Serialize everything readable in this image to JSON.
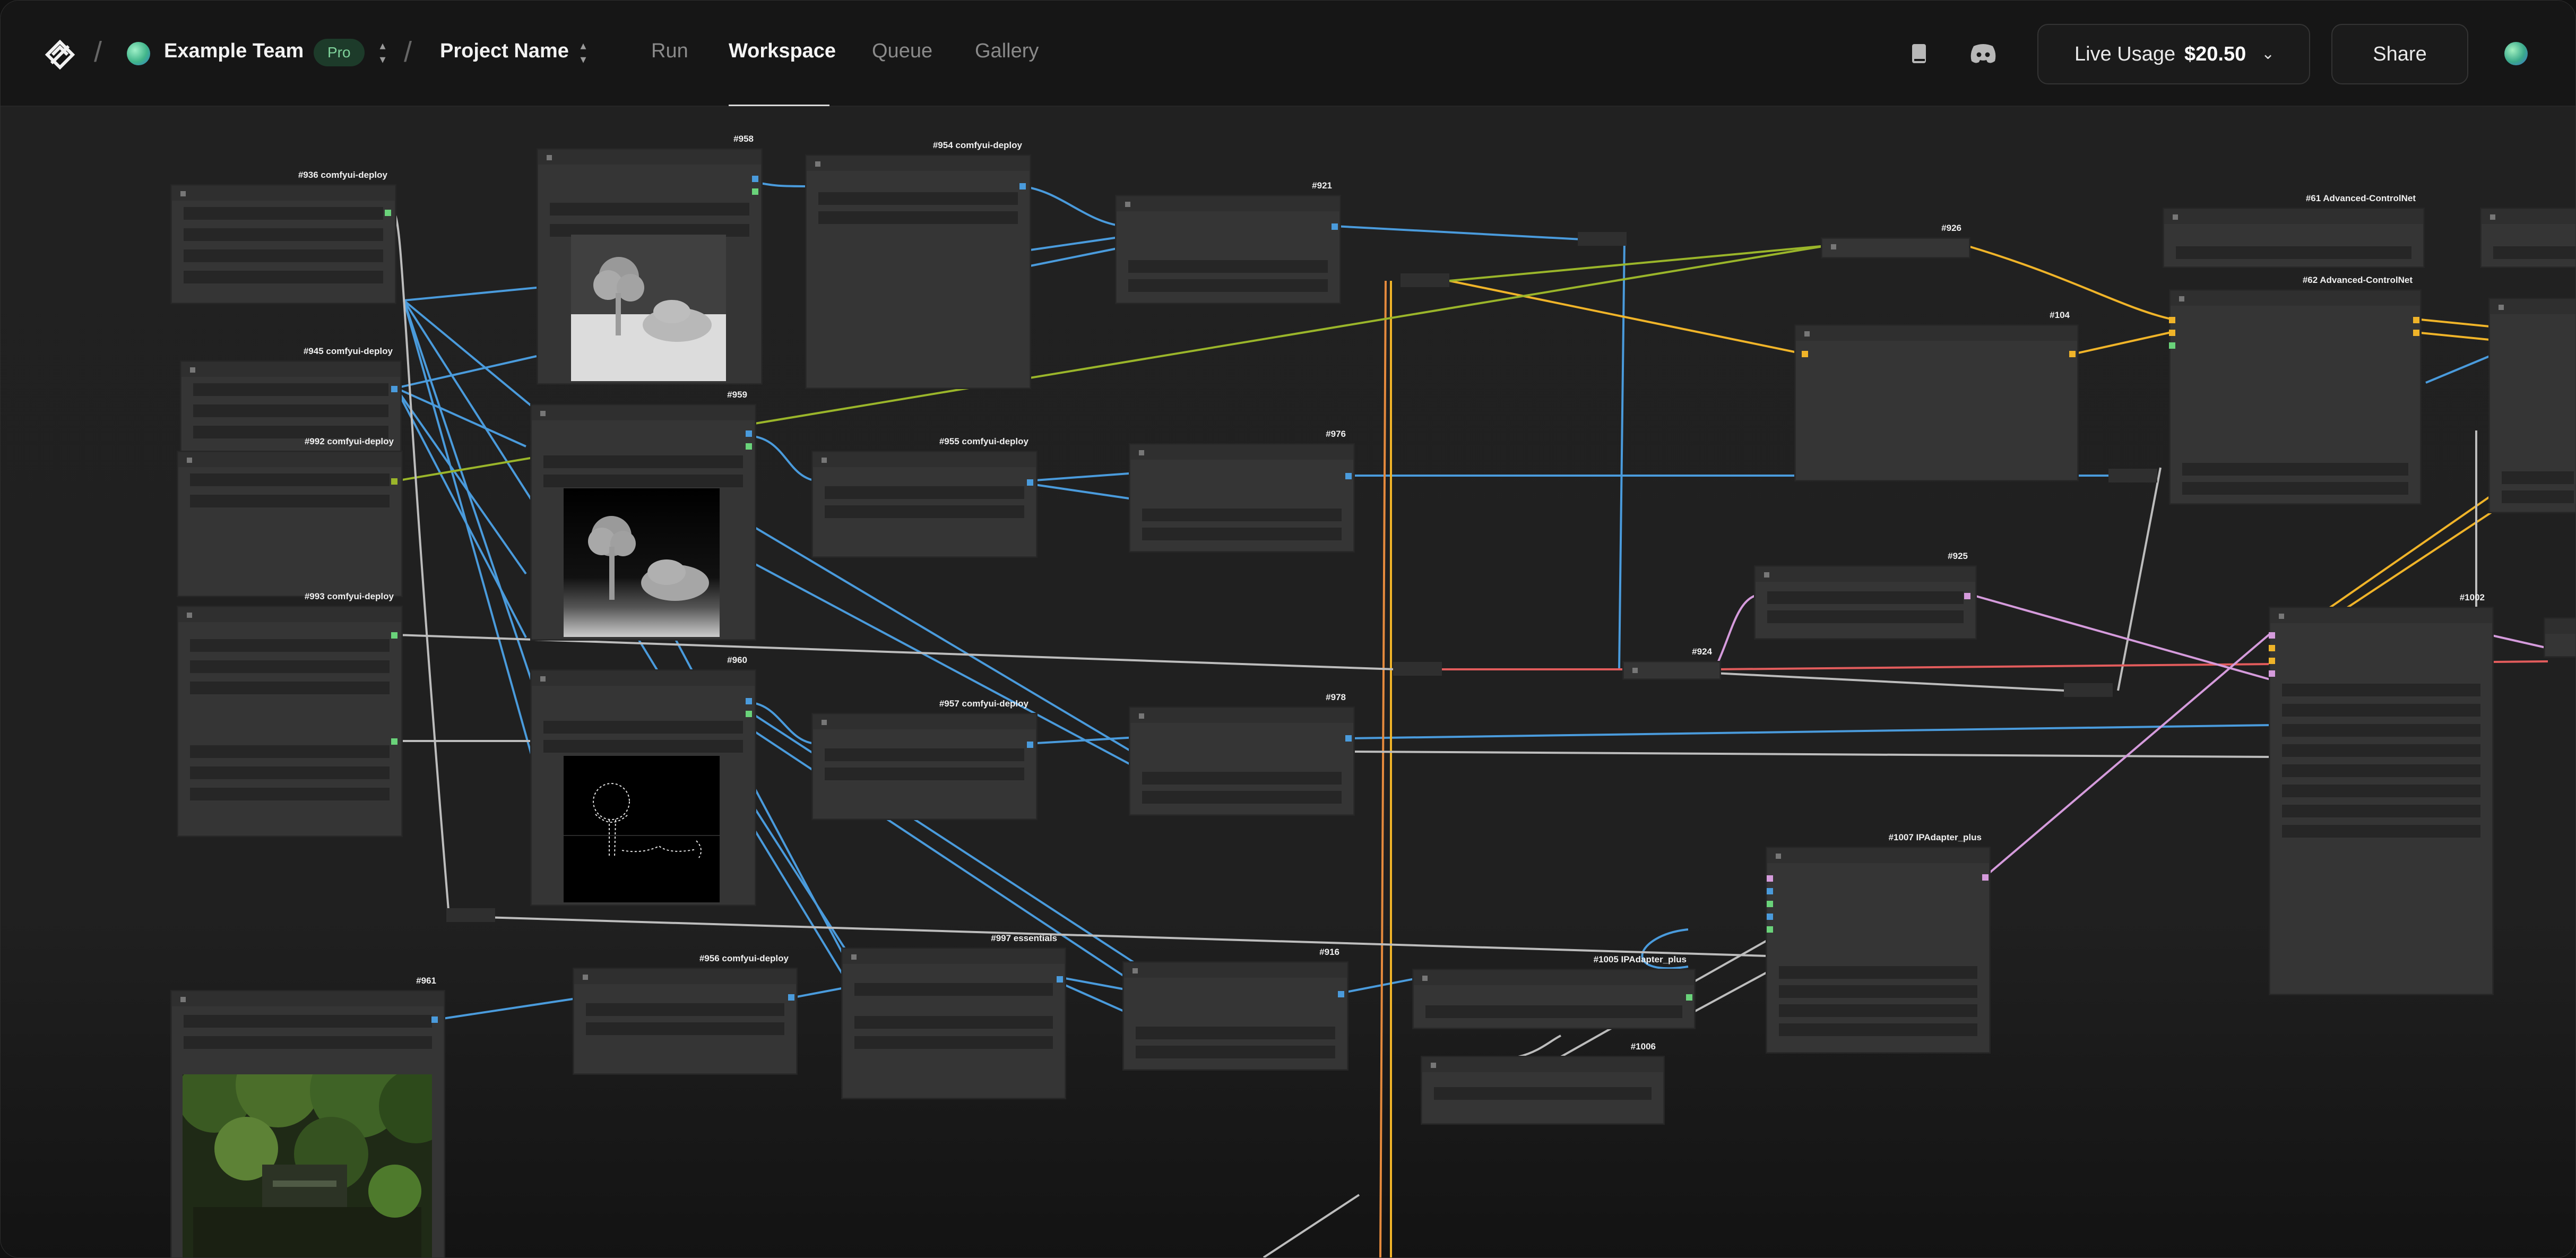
{
  "topbar": {
    "team_name": "Example Team",
    "plan_badge": "Pro",
    "project_name": "Project Name",
    "tabs": [
      {
        "label": "Run",
        "active": false
      },
      {
        "label": "Workspace",
        "active": true
      },
      {
        "label": "Queue",
        "active": false
      },
      {
        "label": "Gallery",
        "active": false
      }
    ],
    "live_usage_label": "Live Usage",
    "live_usage_amount": "$20.50",
    "share_label": "Share",
    "icons": [
      "logo-icon",
      "book-icon",
      "discord-icon",
      "chevron-down-icon"
    ]
  },
  "nodes": {
    "n936": "#936 comfyui-deploy",
    "n958": "#958",
    "n954": "#954 comfyui-deploy",
    "n921": "#921",
    "n926": "#926",
    "n61": "#61 Advanced-ControlNet",
    "n945": "#945 comfyui-deploy",
    "n959": "#959",
    "n955": "#955 comfyui-deploy",
    "n976": "#976",
    "n104": "#104",
    "n62": "#62 Advanced-ControlNet",
    "n992": "#992 comfyui-deploy",
    "n993": "#993 comfyui-deploy",
    "n925": "#925",
    "n924": "#924",
    "n1002": "#1002",
    "n960": "#960",
    "n957": "#957 comfyui-deploy",
    "n978": "#978",
    "n1007": "#1007 IPAdapter_plus",
    "n961": "#961",
    "n956": "#956 comfyui-deploy",
    "n997": "#997 essentials",
    "n916": "#916",
    "n1005": "#1005 IPAdapter_plus",
    "n1006": "#1006"
  },
  "colors": {
    "image_wire": "#4a9bdc",
    "latent_wire": "#f0b429",
    "conditioning_wire": "#9ab52a",
    "ipadapter_wire": "#d59bdc",
    "model_wire": "#c9c9c9",
    "vae_wire": "#e25c5c"
  }
}
